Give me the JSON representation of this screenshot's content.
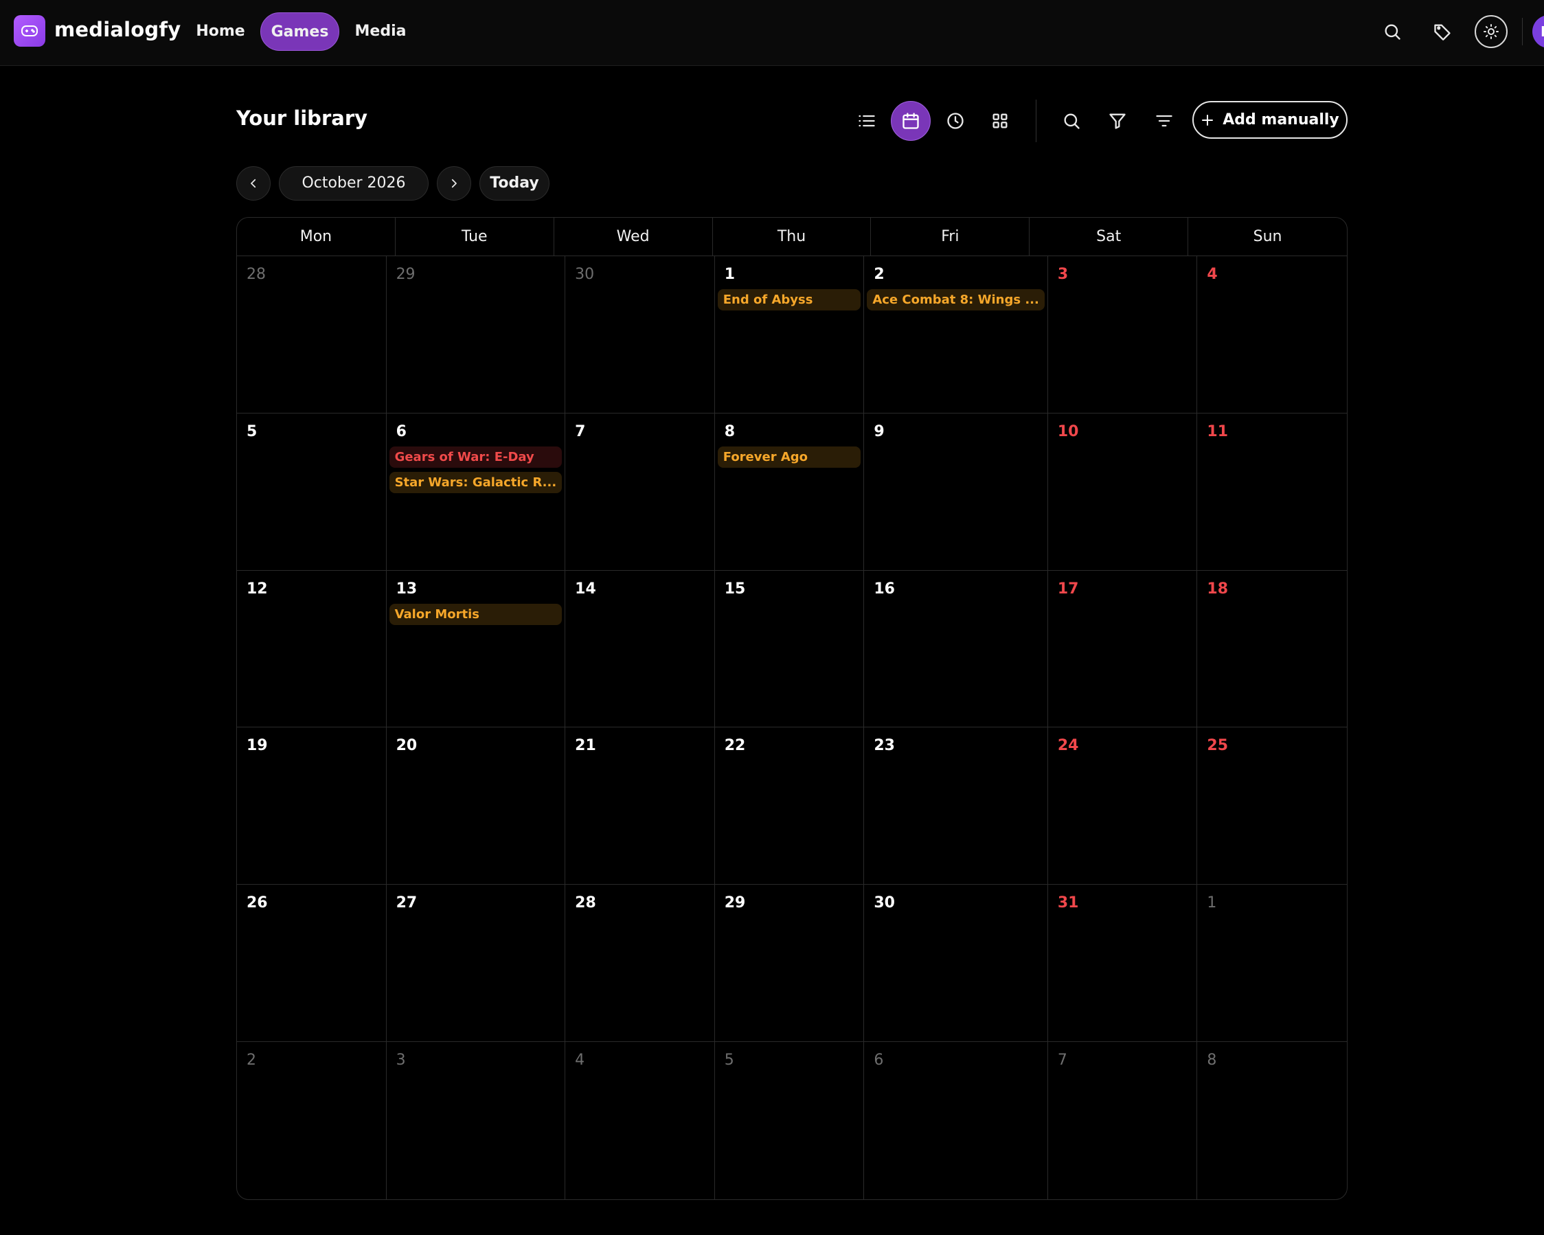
{
  "app": {
    "brand": "medialogfy",
    "avatar_initial": "E"
  },
  "nav": {
    "home": "Home",
    "games": "Games",
    "media": "Media",
    "active": "Games"
  },
  "library": {
    "title": "Your library",
    "add_label": "Add manually",
    "view_modes": [
      "list-icon",
      "calendar-icon",
      "clock-icon",
      "grid-icon"
    ],
    "active_view": "calendar"
  },
  "month_nav": {
    "label": "October 2026",
    "today": "Today"
  },
  "calendar": {
    "weekdays": [
      "Mon",
      "Tue",
      "Wed",
      "Thu",
      "Fri",
      "Sat",
      "Sun"
    ],
    "cells": [
      {
        "day": "28",
        "outside": true,
        "weekend": false,
        "events": []
      },
      {
        "day": "29",
        "outside": true,
        "weekend": false,
        "events": []
      },
      {
        "day": "30",
        "outside": true,
        "weekend": false,
        "events": []
      },
      {
        "day": "1",
        "outside": false,
        "weekend": false,
        "events": [
          {
            "title": "End of Abyss",
            "color": "amber"
          }
        ]
      },
      {
        "day": "2",
        "outside": false,
        "weekend": false,
        "events": [
          {
            "title": "Ace Combat 8: Wings ...",
            "color": "amber"
          }
        ]
      },
      {
        "day": "3",
        "outside": false,
        "weekend": true,
        "events": []
      },
      {
        "day": "4",
        "outside": false,
        "weekend": true,
        "events": []
      },
      {
        "day": "5",
        "outside": false,
        "weekend": false,
        "events": []
      },
      {
        "day": "6",
        "outside": false,
        "weekend": false,
        "events": [
          {
            "title": "Gears of War: E-Day",
            "color": "red"
          },
          {
            "title": "Star Wars: Galactic R...",
            "color": "amber"
          }
        ]
      },
      {
        "day": "7",
        "outside": false,
        "weekend": false,
        "events": []
      },
      {
        "day": "8",
        "outside": false,
        "weekend": false,
        "events": [
          {
            "title": "Forever Ago",
            "color": "amber"
          }
        ]
      },
      {
        "day": "9",
        "outside": false,
        "weekend": false,
        "events": []
      },
      {
        "day": "10",
        "outside": false,
        "weekend": true,
        "events": []
      },
      {
        "day": "11",
        "outside": false,
        "weekend": true,
        "events": []
      },
      {
        "day": "12",
        "outside": false,
        "weekend": false,
        "events": []
      },
      {
        "day": "13",
        "outside": false,
        "weekend": false,
        "events": [
          {
            "title": "Valor Mortis",
            "color": "amber"
          }
        ]
      },
      {
        "day": "14",
        "outside": false,
        "weekend": false,
        "events": []
      },
      {
        "day": "15",
        "outside": false,
        "weekend": false,
        "events": []
      },
      {
        "day": "16",
        "outside": false,
        "weekend": false,
        "events": []
      },
      {
        "day": "17",
        "outside": false,
        "weekend": true,
        "events": []
      },
      {
        "day": "18",
        "outside": false,
        "weekend": true,
        "events": []
      },
      {
        "day": "19",
        "outside": false,
        "weekend": false,
        "events": []
      },
      {
        "day": "20",
        "outside": false,
        "weekend": false,
        "events": []
      },
      {
        "day": "21",
        "outside": false,
        "weekend": false,
        "events": []
      },
      {
        "day": "22",
        "outside": false,
        "weekend": false,
        "events": []
      },
      {
        "day": "23",
        "outside": false,
        "weekend": false,
        "events": []
      },
      {
        "day": "24",
        "outside": false,
        "weekend": true,
        "events": []
      },
      {
        "day": "25",
        "outside": false,
        "weekend": true,
        "events": []
      },
      {
        "day": "26",
        "outside": false,
        "weekend": false,
        "events": []
      },
      {
        "day": "27",
        "outside": false,
        "weekend": false,
        "events": []
      },
      {
        "day": "28",
        "outside": false,
        "weekend": false,
        "events": []
      },
      {
        "day": "29",
        "outside": false,
        "weekend": false,
        "events": []
      },
      {
        "day": "30",
        "outside": false,
        "weekend": false,
        "events": []
      },
      {
        "day": "31",
        "outside": false,
        "weekend": true,
        "events": []
      },
      {
        "day": "1",
        "outside": true,
        "weekend": true,
        "events": []
      },
      {
        "day": "2",
        "outside": true,
        "weekend": false,
        "events": []
      },
      {
        "day": "3",
        "outside": true,
        "weekend": false,
        "events": []
      },
      {
        "day": "4",
        "outside": true,
        "weekend": false,
        "events": []
      },
      {
        "day": "5",
        "outside": true,
        "weekend": false,
        "events": []
      },
      {
        "day": "6",
        "outside": true,
        "weekend": false,
        "events": []
      },
      {
        "day": "7",
        "outside": true,
        "weekend": true,
        "events": []
      },
      {
        "day": "8",
        "outside": true,
        "weekend": true,
        "events": []
      }
    ]
  },
  "colors": {
    "accent": "#7a36b8",
    "weekend": "#f0474b",
    "event_amber": "#f6a72a",
    "event_red": "#f04a4a"
  }
}
